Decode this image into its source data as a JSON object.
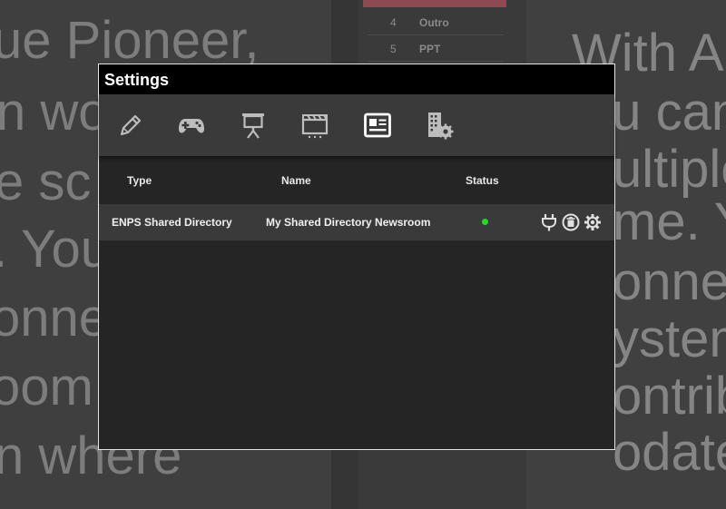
{
  "background": {
    "left_lines": [
      "ue Pioneer,",
      "n wo",
      "e sc",
      ". You",
      "onne",
      "oom",
      "n where"
    ],
    "right_lines": [
      "With Au",
      "ou can",
      "ultiple",
      "me. Yo",
      "onnec",
      "ystem",
      "ontribu",
      "odate"
    ],
    "list_items": [
      {
        "num": "4",
        "label": "Outro"
      },
      {
        "num": "5",
        "label": "PPT"
      }
    ]
  },
  "dialog": {
    "title": "Settings",
    "toolbar": [
      {
        "icon": "pencil-icon"
      },
      {
        "icon": "gamepad-icon"
      },
      {
        "icon": "presentation-icon"
      },
      {
        "icon": "clapperboard-icon"
      },
      {
        "icon": "newspaper-icon",
        "active": true
      },
      {
        "icon": "building-settings-icon"
      }
    ],
    "columns": {
      "type": "Type",
      "name": "Name",
      "status": "Status"
    },
    "rows": [
      {
        "type": "ENPS Shared Directory",
        "name": "My Shared Directory Newsroom",
        "status": "connected"
      }
    ],
    "colors": {
      "status_ok": "#22dd22",
      "icon": "#bdbdbd",
      "icon_active": "#ffffff"
    }
  }
}
